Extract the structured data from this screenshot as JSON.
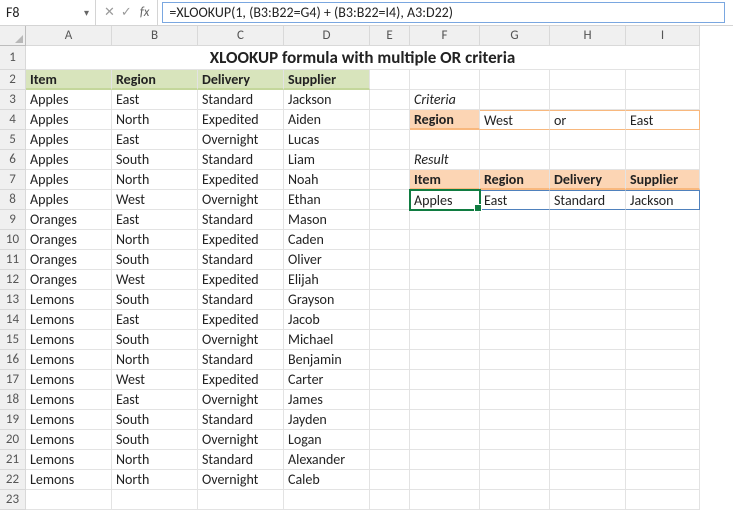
{
  "nameBox": "F8",
  "formula": "=XLOOKUP(1, (B3:B22=G4) + (B3:B22=I4), A3:D22)",
  "title": "XLOOKUP formula with multiple OR criteria",
  "columns": [
    "A",
    "B",
    "C",
    "D",
    "E",
    "F",
    "G",
    "H",
    "I"
  ],
  "rows": [
    "1",
    "2",
    "3",
    "4",
    "5",
    "6",
    "7",
    "8",
    "9",
    "10",
    "11",
    "12",
    "13",
    "14",
    "15",
    "16",
    "17",
    "18",
    "19",
    "20",
    "21",
    "22",
    "23"
  ],
  "headers": {
    "item": "Item",
    "region": "Region",
    "delivery": "Delivery",
    "supplier": "Supplier"
  },
  "table": [
    {
      "item": "Apples",
      "region": "East",
      "delivery": "Standard",
      "supplier": "Jackson"
    },
    {
      "item": "Apples",
      "region": "North",
      "delivery": "Expedited",
      "supplier": "Aiden"
    },
    {
      "item": "Apples",
      "region": "East",
      "delivery": "Overnight",
      "supplier": "Lucas"
    },
    {
      "item": "Apples",
      "region": "South",
      "delivery": "Standard",
      "supplier": "Liam"
    },
    {
      "item": "Apples",
      "region": "North",
      "delivery": "Expedited",
      "supplier": "Noah"
    },
    {
      "item": "Apples",
      "region": "West",
      "delivery": "Overnight",
      "supplier": "Ethan"
    },
    {
      "item": "Oranges",
      "region": "East",
      "delivery": "Standard",
      "supplier": "Mason"
    },
    {
      "item": "Oranges",
      "region": "North",
      "delivery": "Expedited",
      "supplier": "Caden"
    },
    {
      "item": "Oranges",
      "region": "South",
      "delivery": "Standard",
      "supplier": "Oliver"
    },
    {
      "item": "Oranges",
      "region": "West",
      "delivery": "Expedited",
      "supplier": "Elijah"
    },
    {
      "item": "Lemons",
      "region": "South",
      "delivery": "Standard",
      "supplier": "Grayson"
    },
    {
      "item": "Lemons",
      "region": "East",
      "delivery": "Expedited",
      "supplier": "Jacob"
    },
    {
      "item": "Lemons",
      "region": "South",
      "delivery": "Overnight",
      "supplier": "Michael"
    },
    {
      "item": "Lemons",
      "region": "North",
      "delivery": "Standard",
      "supplier": "Benjamin"
    },
    {
      "item": "Lemons",
      "region": "West",
      "delivery": "Expedited",
      "supplier": "Carter"
    },
    {
      "item": "Lemons",
      "region": "East",
      "delivery": "Overnight",
      "supplier": "James"
    },
    {
      "item": "Lemons",
      "region": "South",
      "delivery": "Standard",
      "supplier": "Jayden"
    },
    {
      "item": "Lemons",
      "region": "South",
      "delivery": "Overnight",
      "supplier": "Logan"
    },
    {
      "item": "Lemons",
      "region": "North",
      "delivery": "Standard",
      "supplier": "Alexander"
    },
    {
      "item": "Lemons",
      "region": "North",
      "delivery": "Overnight",
      "supplier": "Caleb"
    }
  ],
  "side": {
    "criteriaLabel": "Criteria",
    "regionLabel": "Region",
    "crit1": "West",
    "orLabel": "or",
    "crit2": "East",
    "resultLabel": "Result",
    "res": {
      "item": "Apples",
      "region": "East",
      "delivery": "Standard",
      "supplier": "Jackson"
    }
  }
}
